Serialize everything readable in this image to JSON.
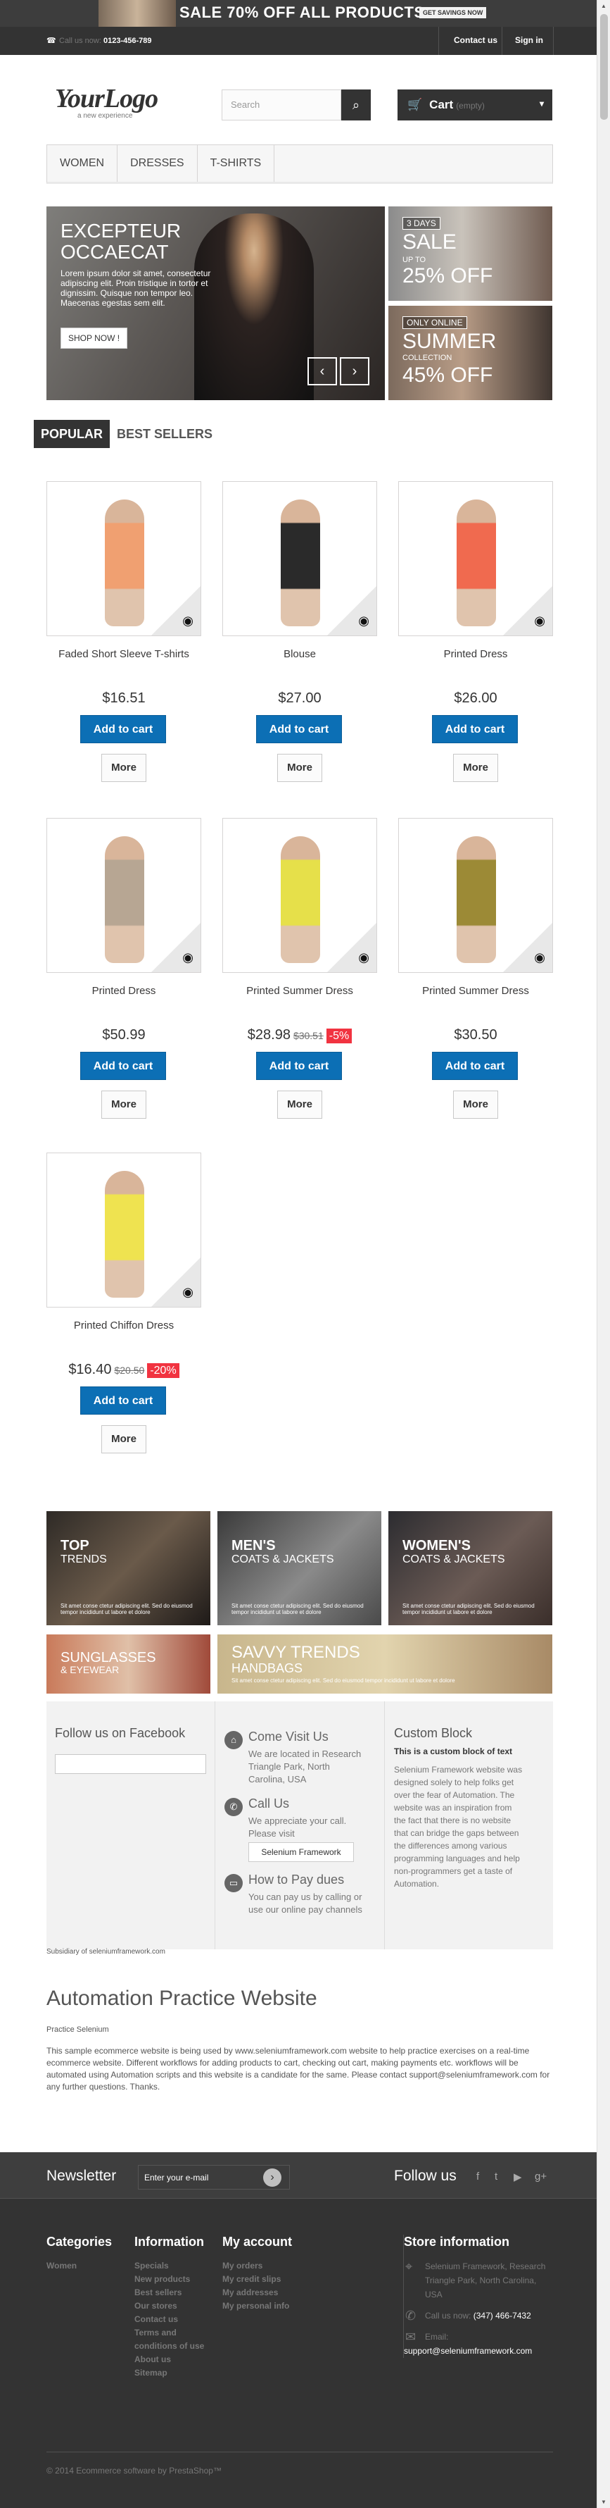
{
  "banner": {
    "text": "SALE 70% OFF ALL PRODUCTS",
    "button": "GET SAVINGS NOW"
  },
  "nav": {
    "call_label": "Call us now:",
    "phone": "0123-456-789",
    "contact": "Contact us",
    "signin": "Sign in"
  },
  "header": {
    "logo": "YourLogo",
    "logo_sub": "a new experience",
    "search_placeholder": "Search",
    "cart": "Cart",
    "cart_empty": "(empty)"
  },
  "menu": [
    "WOMEN",
    "DRESSES",
    "T-SHIRTS"
  ],
  "slider": {
    "title": "EXCEPTEUR OCCAECAT",
    "text": "Lorem ipsum dolor sit amet, consectetur adipiscing elit. Proin tristique in tortor et dignissim. Quisque non tempor leo. Maecenas egestas sem elit.",
    "button": "SHOP NOW !"
  },
  "promo1": {
    "tag": "3 DAYS",
    "big1": "SALE",
    "small": "UP TO",
    "big2": "25% OFF"
  },
  "promo2": {
    "tag": "ONLY ONLINE",
    "big1": "SUMMER",
    "small": "COLLECTION",
    "big2": "45% OFF"
  },
  "tabs": [
    "POPULAR",
    "BEST SELLERS"
  ],
  "products": [
    {
      "name": "Faded Short Sleeve T-shirts",
      "price": "$16.51",
      "old": "",
      "discount": "",
      "color": "#f0a071"
    },
    {
      "name": "Blouse",
      "price": "$27.00",
      "old": "",
      "discount": "",
      "color": "#2a2a2a"
    },
    {
      "name": "Printed Dress",
      "price": "$26.00",
      "old": "",
      "discount": "",
      "color": "#f06a4f"
    },
    {
      "name": "Printed Dress",
      "price": "$50.99",
      "old": "",
      "discount": "",
      "color": "#b7a693"
    },
    {
      "name": "Printed Summer Dress",
      "price": "$28.98",
      "old": "$30.51",
      "discount": "-5%",
      "color": "#e6e04a"
    },
    {
      "name": "Printed Summer Dress",
      "price": "$30.50",
      "old": "",
      "discount": "",
      "color": "#9c8a36"
    },
    {
      "name": "Printed Chiffon Dress",
      "price": "$16.40",
      "old": "$20.50",
      "discount": "-20%",
      "color": "#efe350"
    }
  ],
  "buttons": {
    "add": "Add to cart",
    "more": "More"
  },
  "banners": [
    {
      "t1": "TOP",
      "t2": "TRENDS",
      "d": "Sit amet conse ctetur adipiscing elit. Sed do eiusmod tempor incididunt ut labore et dolore"
    },
    {
      "t1": "MEN'S",
      "t2": "COATS & JACKETS",
      "d": "Sit amet conse ctetur adipiscing elit. Sed do eiusmod tempor incididunt ut labore et dolore"
    },
    {
      "t1": "WOMEN'S",
      "t2": "COATS & JACKETS",
      "d": "Sit amet conse ctetur adipiscing elit. Sed do eiusmod tempor incididunt ut labore et dolore"
    },
    {
      "t1": "SUNGLASSES",
      "t2": "& EYEWEAR",
      "d": ""
    },
    {
      "t1": "SAVVY TRENDS",
      "t2": "HANDBAGS",
      "d": "Sit amet conse ctetur adipiscing elit. Sed do eiusmod tempor incididunt ut labore et dolore"
    }
  ],
  "info": {
    "fb_title": "Follow us on Facebook",
    "visit_title": "Come Visit Us",
    "visit_text": "We are located in Research Triangle Park, North Carolina, USA",
    "call_title": "Call Us",
    "call_text": "We appreciate your call. Please visit",
    "call_link": "Selenium Framework",
    "pay_title": "How to Pay dues",
    "pay_text": "You can pay us by calling or use our online pay channels",
    "custom_title": "Custom Block",
    "custom_bold": "This is a custom block of text",
    "custom_text": "Selenium Framework website was designed solely to help folks get over the fear of Automation. The website was an inspiration from the fact that there is no website that can bridge the gaps between the differences among various programming languages and help non-programmers get a taste of Automation."
  },
  "subsidiary": "Subsidiary of seleniumframework.com",
  "seo": {
    "title": "Automation Practice Website",
    "sub": "Practice Selenium",
    "desc": "This sample ecommerce website is being used by www.seleniumframework.com website to help practice exercises on a real-time ecommerce website. Different workflows for adding products to cart, checking out cart, making payments etc. workflows will be automated using Automation scripts and this website is a candidate for the same. Please contact support@seleniumframework.com for any further questions. Thanks."
  },
  "footer": {
    "newsletter": "Newsletter",
    "nl_placeholder": "Enter your e-mail",
    "follow": "Follow us",
    "categories_title": "Categories",
    "categories": [
      "Women"
    ],
    "information_title": "Information",
    "information": [
      "Specials",
      "New products",
      "Best sellers",
      "Our stores",
      "Contact us",
      "Terms and conditions of use",
      "About us",
      "Sitemap"
    ],
    "account_title": "My account",
    "account": [
      "My orders",
      "My credit slips",
      "My addresses",
      "My personal info"
    ],
    "store_title": "Store information",
    "store_address": "Selenium Framework, Research Triangle Park, North Carolina, USA",
    "store_call_label": "Call us now:",
    "store_phone": "(347) 466-7432",
    "store_email_label": "Email:",
    "store_email": "support@seleniumframework.com",
    "copyright": "© 2014 Ecommerce software by PrestaShop™"
  }
}
